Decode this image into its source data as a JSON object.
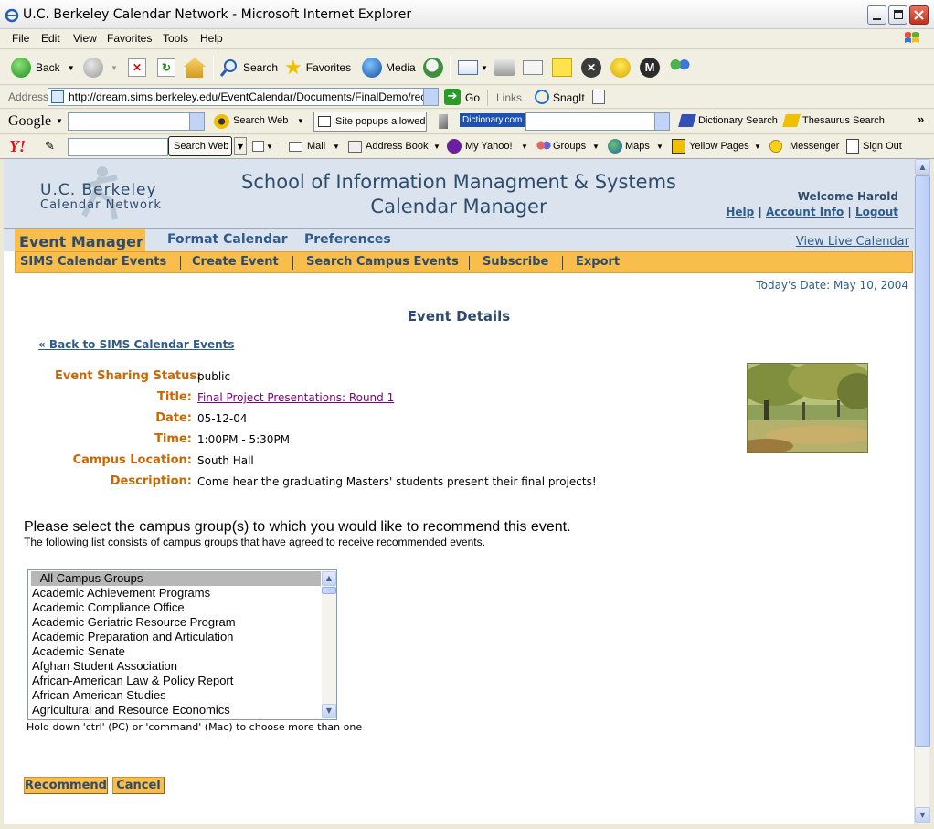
{
  "browser": {
    "window_title": "U.C. Berkeley Calendar Network - Microsoft Internet Explorer",
    "menu": [
      "File",
      "Edit",
      "View",
      "Favorites",
      "Tools",
      "Help"
    ],
    "toolbar": {
      "back": "Back",
      "search": "Search",
      "favorites": "Favorites",
      "media": "Media"
    },
    "address": {
      "label": "Address",
      "url": "http://dream.sims.berkeley.edu/EventCalendar/Documents/FinalDemo/recomme",
      "go": "Go",
      "links": "Links",
      "snagit": "SnagIt"
    },
    "google_bar": {
      "logo": "Google",
      "search_web": "Search Web",
      "popups": "Site popups allowed",
      "dictionary_logo": "Dictionary.com",
      "dictionary_search": "Dictionary Search",
      "thesaurus_search": "Thesaurus Search"
    },
    "yahoo_bar": {
      "logo": "Y!",
      "search_web": "Search Web",
      "mail": "Mail",
      "address_book": "Address Book",
      "my_yahoo": "My Yahoo!",
      "groups": "Groups",
      "maps": "Maps",
      "yellow_pages": "Yellow Pages",
      "messenger": "Messenger",
      "sign_out": "Sign Out"
    }
  },
  "header": {
    "logo_line1": "U.C. Berkeley",
    "logo_line2": "Calendar Network",
    "title_line1": "School of Information Managment & Systems",
    "title_line2": "Calendar Manager",
    "welcome": "Welcome Harold",
    "help": "Help",
    "account_info": "Account Info",
    "logout": "Logout"
  },
  "nav": {
    "tabs": [
      "Event Manager",
      "Format Calendar",
      "Preferences"
    ],
    "view_live": "View Live Calendar",
    "sub": [
      "SIMS Calendar Events",
      "Create Event",
      "Search Campus Events",
      "Subscribe",
      "Export"
    ]
  },
  "page": {
    "today": "Today's Date: May 10, 2004",
    "title": "Event Details",
    "back_link": "« Back to SIMS Calendar Events"
  },
  "event": {
    "sharing_label": "Event Sharing Status:",
    "sharing": "public",
    "title_label": "Title:",
    "title": "Final Project Presentations: Round 1",
    "date_label": "Date:",
    "date": "05-12-04",
    "time_label": "Time:",
    "time": "1:00PM - 5:30PM",
    "location_label": "Campus Location:",
    "location": "South Hall",
    "description_label": "Description:",
    "description": "Come hear the graduating Masters' students present their final projects!"
  },
  "recommend": {
    "question": "Please select the campus group(s) to which you would like to recommend this event.",
    "subtext": "The following list consists of campus groups that have agreed to receive recommended events.",
    "groups": [
      "--All Campus Groups--",
      "Academic Achievement Programs",
      "Academic Compliance Office",
      "Academic Geriatric Resource Program",
      "Academic Preparation and Articulation",
      "Academic Senate",
      "Afghan Student Association",
      "African-American Law & Policy Report",
      "African-American Studies",
      "Agricultural and Resource Economics"
    ],
    "selected_index": 0,
    "hint": "Hold down 'ctrl' (PC) or 'command' (Mac) to choose more than one",
    "recommend_button": "Recommend",
    "cancel_button": "Cancel"
  }
}
